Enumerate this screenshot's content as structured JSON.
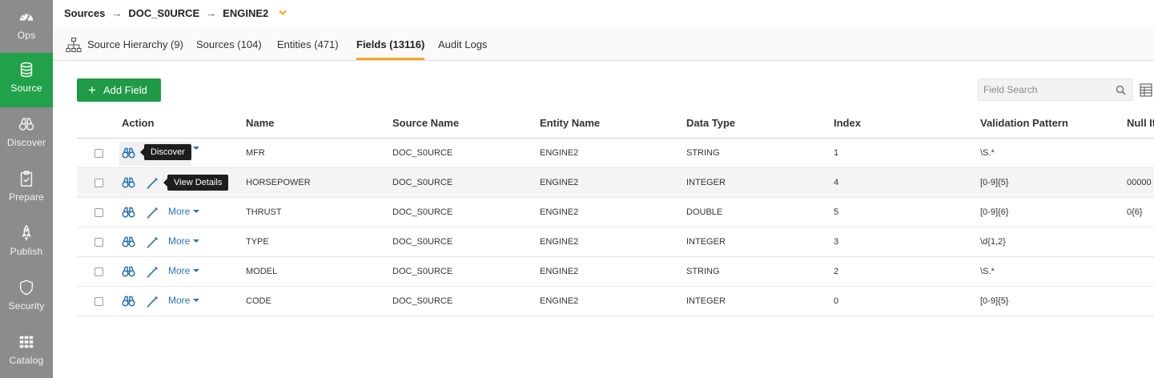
{
  "sidebar": {
    "items": [
      {
        "label": "Ops",
        "icon": "speedometer-icon"
      },
      {
        "label": "Source",
        "icon": "database-icon"
      },
      {
        "label": "Discover",
        "icon": "binoculars-icon"
      },
      {
        "label": "Prepare",
        "icon": "clipboard-icon"
      },
      {
        "label": "Publish",
        "icon": "rocket-icon"
      },
      {
        "label": "Security",
        "icon": "shield-icon"
      },
      {
        "label": "Catalog",
        "icon": "grid-icon"
      }
    ],
    "active": "Source",
    "active_color": "#21a24a"
  },
  "breadcrumb": {
    "items": [
      "Sources",
      "DOC_S0URCE",
      "ENGINE2"
    ],
    "separator": "→"
  },
  "tabs": [
    {
      "label": "Source Hierarchy (9)"
    },
    {
      "label": "Sources (104)"
    },
    {
      "label": "Entities (471)"
    },
    {
      "label": "Fields (13116)"
    },
    {
      "label": "Audit Logs"
    }
  ],
  "active_tab": "Fields (13116)",
  "accent_color": "#f5a623",
  "toolbar": {
    "add_label": "Add Field",
    "search_placeholder": "Field Search"
  },
  "table": {
    "columns": [
      "Action",
      "Name",
      "Source Name",
      "Entity Name",
      "Data Type",
      "Index",
      "Validation Pattern",
      "Null If"
    ],
    "more_label": "More",
    "rows": [
      {
        "name": "MFR",
        "source": "DOC_S0URCE",
        "entity": "ENGINE2",
        "type": "STRING",
        "index": "1",
        "pattern": "\\S.*",
        "null_if": ""
      },
      {
        "name": "HORSEPOWER",
        "source": "DOC_S0URCE",
        "entity": "ENGINE2",
        "type": "INTEGER",
        "index": "4",
        "pattern": "[0-9]{5}",
        "null_if": "00000"
      },
      {
        "name": "THRUST",
        "source": "DOC_S0URCE",
        "entity": "ENGINE2",
        "type": "DOUBLE",
        "index": "5",
        "pattern": "[0-9]{6}",
        "null_if": "0{6}"
      },
      {
        "name": "TYPE",
        "source": "DOC_S0URCE",
        "entity": "ENGINE2",
        "type": "INTEGER",
        "index": "3",
        "pattern": "\\d{1,2}",
        "null_if": ""
      },
      {
        "name": "MODEL",
        "source": "DOC_S0URCE",
        "entity": "ENGINE2",
        "type": "STRING",
        "index": "2",
        "pattern": "\\S.*",
        "null_if": ""
      },
      {
        "name": "CODE",
        "source": "DOC_S0URCE",
        "entity": "ENGINE2",
        "type": "INTEGER",
        "index": "0",
        "pattern": "[0-9]{5}",
        "null_if": ""
      }
    ]
  },
  "tooltips": {
    "discover": "Discover",
    "view_details": "View Details"
  }
}
